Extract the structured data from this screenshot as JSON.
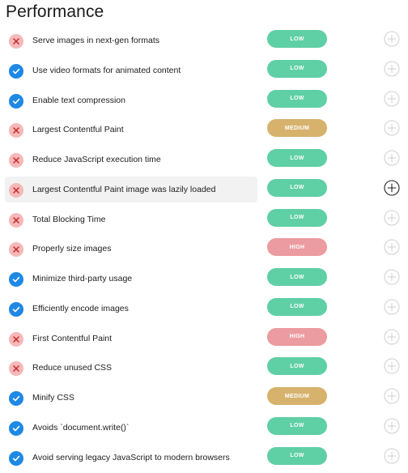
{
  "page": {
    "title": "Performance"
  },
  "colors": {
    "fail_bg": "#f6b8b8",
    "fail_mark": "#c62828",
    "pass_bg": "#1e88e5",
    "low": "#5fcfa6",
    "medium": "#d6b26c",
    "high": "#ec9ba0",
    "add_inactive": "#cfcfcf",
    "add_active": "#222222"
  },
  "audits": [
    {
      "label": "Serve images in next-gen formats",
      "status": "fail",
      "status_icon": "x-icon",
      "impact": "LOW",
      "impact_level": "low",
      "add_icon": "plus-circle-icon",
      "highlighted": false
    },
    {
      "label": "Use video formats for animated content",
      "status": "pass",
      "status_icon": "check-icon",
      "impact": "LOW",
      "impact_level": "low",
      "add_icon": "plus-circle-icon",
      "highlighted": false
    },
    {
      "label": "Enable text compression",
      "status": "pass",
      "status_icon": "check-icon",
      "impact": "LOW",
      "impact_level": "low",
      "add_icon": "plus-circle-icon",
      "highlighted": false
    },
    {
      "label": "Largest Contentful Paint",
      "status": "fail",
      "status_icon": "x-icon",
      "impact": "MEDIUM",
      "impact_level": "medium",
      "add_icon": "plus-circle-icon",
      "highlighted": false
    },
    {
      "label": "Reduce JavaScript execution time",
      "status": "fail",
      "status_icon": "x-icon",
      "impact": "LOW",
      "impact_level": "low",
      "add_icon": "plus-circle-icon",
      "highlighted": false
    },
    {
      "label": "Largest Contentful Paint image was lazily loaded",
      "status": "fail",
      "status_icon": "x-icon",
      "impact": "LOW",
      "impact_level": "low",
      "add_icon": "plus-circle-icon",
      "highlighted": true
    },
    {
      "label": "Total Blocking Time",
      "status": "fail",
      "status_icon": "x-icon",
      "impact": "LOW",
      "impact_level": "low",
      "add_icon": "plus-circle-icon",
      "highlighted": false
    },
    {
      "label": "Properly size images",
      "status": "fail",
      "status_icon": "x-icon",
      "impact": "HIGH",
      "impact_level": "high",
      "add_icon": "plus-circle-icon",
      "highlighted": false
    },
    {
      "label": "Minimize third-party usage",
      "status": "pass",
      "status_icon": "check-icon",
      "impact": "LOW",
      "impact_level": "low",
      "add_icon": "plus-circle-icon",
      "highlighted": false
    },
    {
      "label": "Efficiently encode images",
      "status": "pass",
      "status_icon": "check-icon",
      "impact": "LOW",
      "impact_level": "low",
      "add_icon": "plus-circle-icon",
      "highlighted": false
    },
    {
      "label": "First Contentful Paint",
      "status": "fail",
      "status_icon": "x-icon",
      "impact": "HIGH",
      "impact_level": "high",
      "add_icon": "plus-circle-icon",
      "highlighted": false
    },
    {
      "label": "Reduce unused CSS",
      "status": "fail",
      "status_icon": "x-icon",
      "impact": "LOW",
      "impact_level": "low",
      "add_icon": "plus-circle-icon",
      "highlighted": false
    },
    {
      "label": "Minify CSS",
      "status": "pass",
      "status_icon": "check-icon",
      "impact": "MEDIUM",
      "impact_level": "medium",
      "add_icon": "plus-circle-icon",
      "highlighted": false
    },
    {
      "label": "Avoids `document.write()`",
      "status": "pass",
      "status_icon": "check-icon",
      "impact": "LOW",
      "impact_level": "low",
      "add_icon": "plus-circle-icon",
      "highlighted": false
    },
    {
      "label": "Avoid serving legacy JavaScript to modern browsers",
      "status": "pass",
      "status_icon": "check-icon",
      "impact": "LOW",
      "impact_level": "low",
      "add_icon": "plus-circle-icon",
      "highlighted": false
    }
  ]
}
